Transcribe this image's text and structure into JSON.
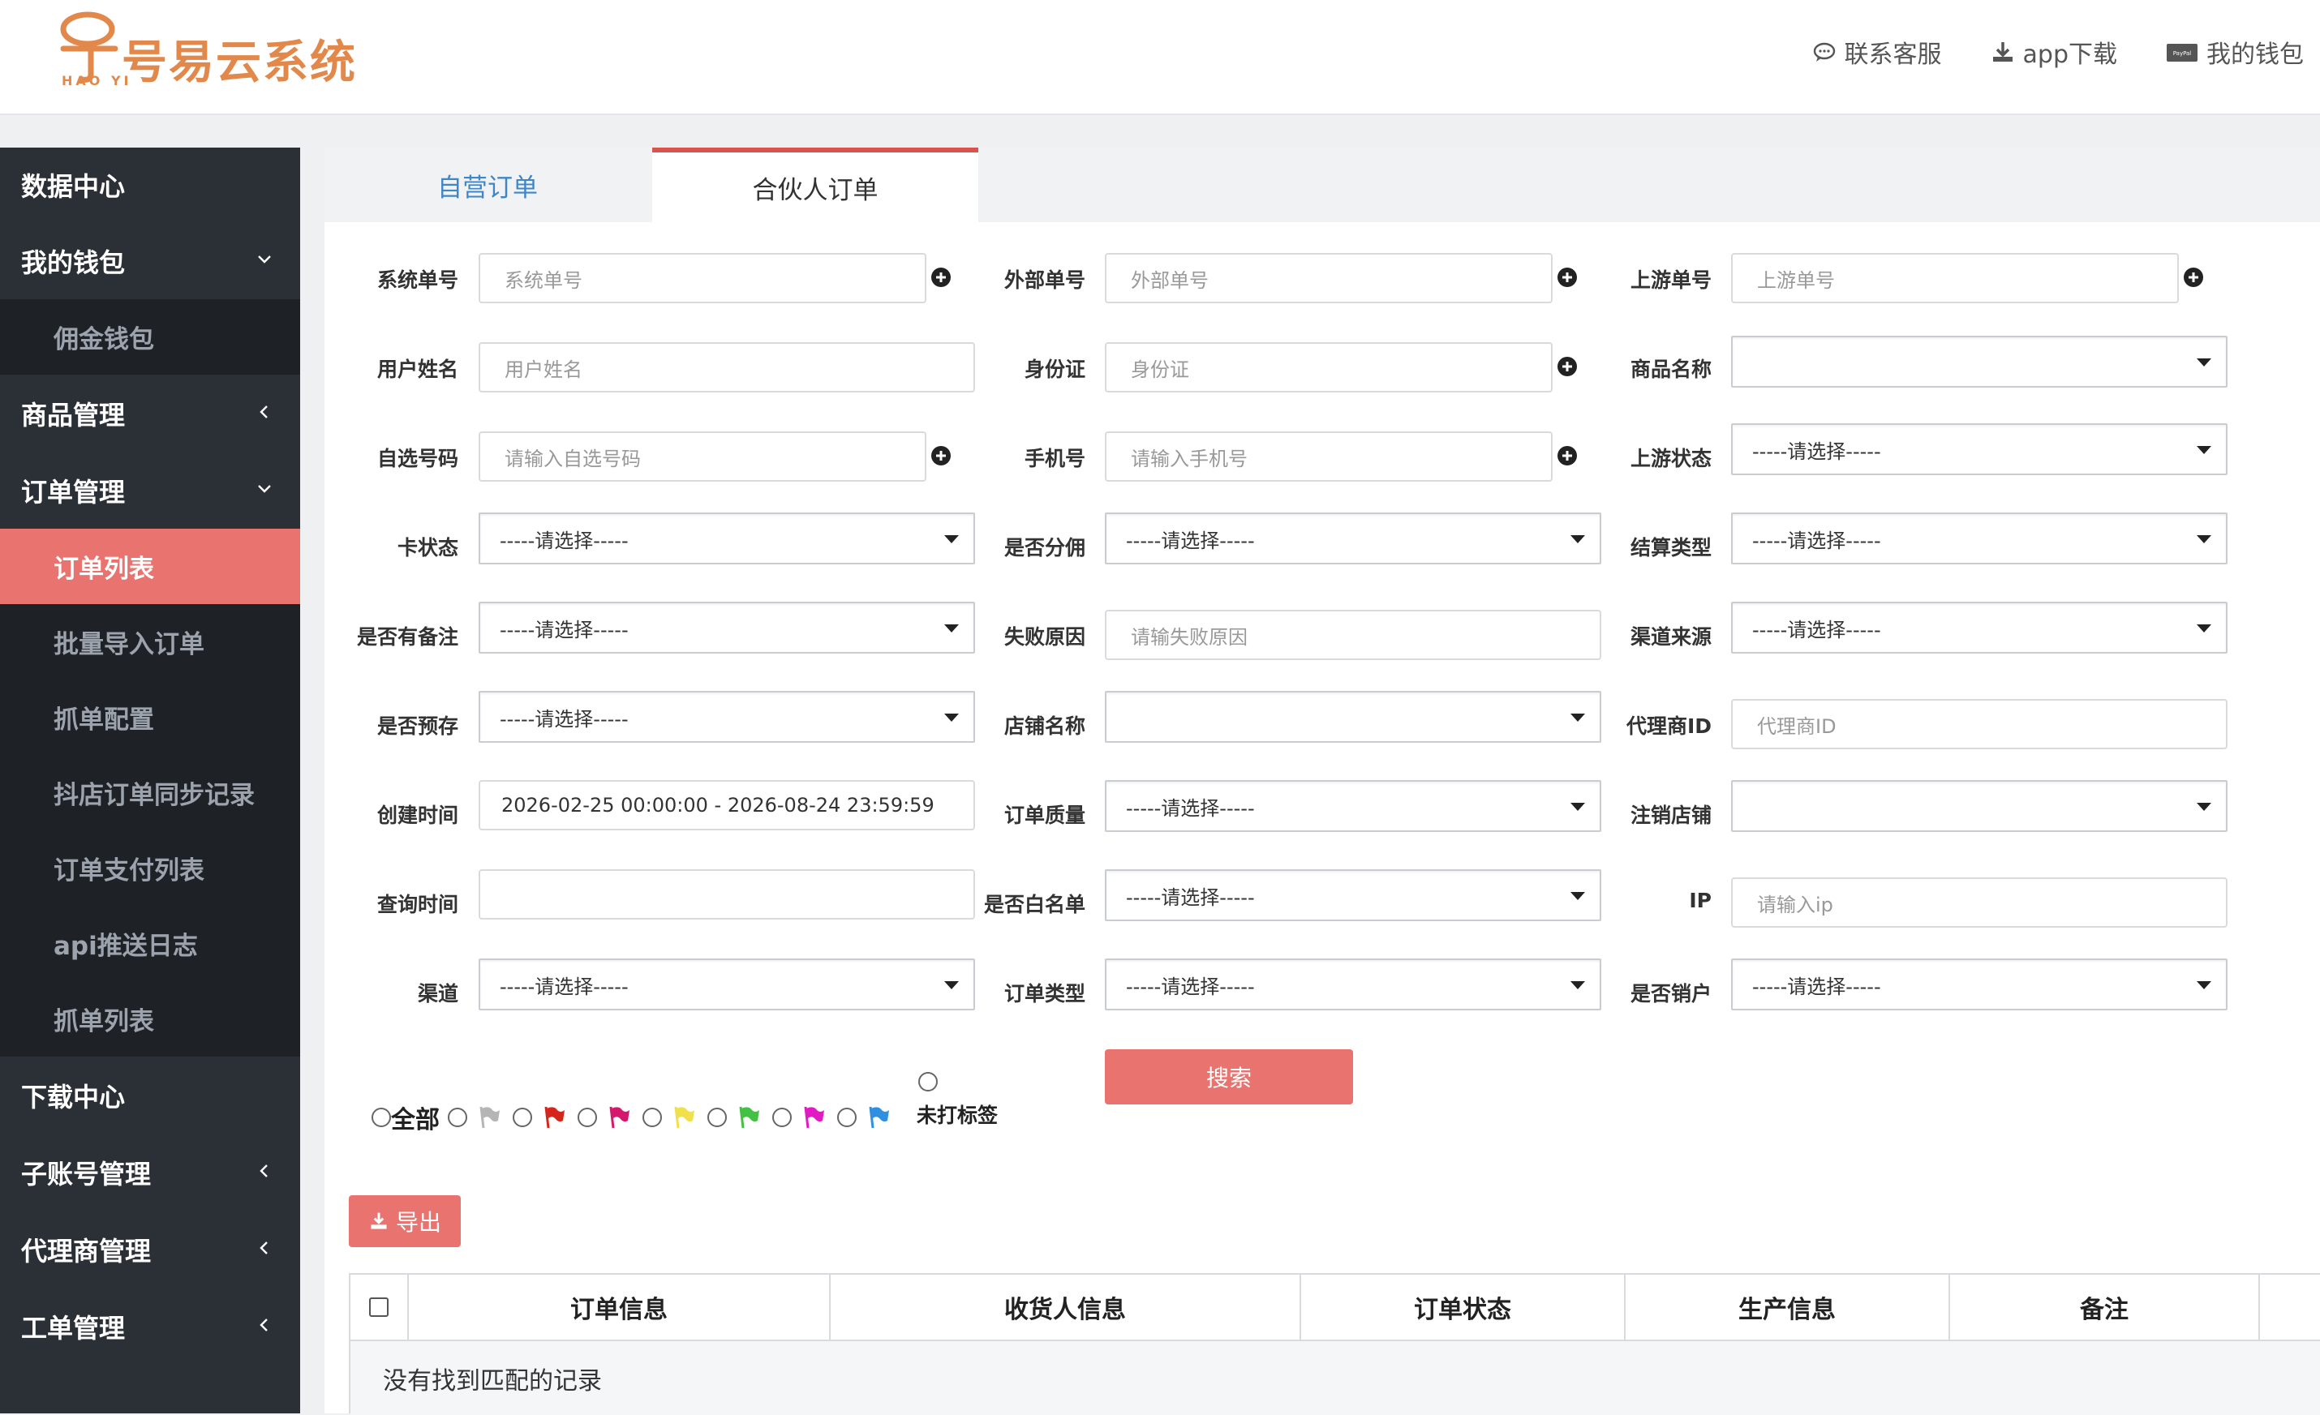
{
  "app": {
    "logo_text": "号易云系统",
    "logo_sub": "HAO YI",
    "brand_color": "#e2884a",
    "accent_color": "#e8736f"
  },
  "header": {
    "service": "联系客服",
    "download": "app下载",
    "wallet": "我的钱包"
  },
  "sidebar": {
    "items": [
      {
        "label": "数据中心",
        "icon": "none",
        "chevron": "none"
      },
      {
        "label": "我的钱包",
        "chevron": "down"
      },
      {
        "label": "佣金钱包",
        "sub": true
      },
      {
        "label": "商品管理",
        "chevron": "left"
      },
      {
        "label": "订单管理",
        "chevron": "down"
      },
      {
        "label": "订单列表",
        "sub": true,
        "active": true
      },
      {
        "label": "批量导入订单",
        "sub": true
      },
      {
        "label": "抓单配置",
        "sub": true
      },
      {
        "label": "抖店订单同步记录",
        "sub": true
      },
      {
        "label": "订单支付列表",
        "sub": true
      },
      {
        "label": "api推送日志",
        "sub": true
      },
      {
        "label": "抓单列表",
        "sub": true
      },
      {
        "label": "下载中心",
        "chevron": "none"
      },
      {
        "label": "子账号管理",
        "chevron": "left"
      },
      {
        "label": "代理商管理",
        "chevron": "left"
      },
      {
        "label": "工单管理",
        "chevron": "left"
      }
    ]
  },
  "tabs": {
    "self": "自营订单",
    "partner": "合伙人订单"
  },
  "form": {
    "sys_no": {
      "label": "系统单号",
      "placeholder": "系统单号"
    },
    "ext_no": {
      "label": "外部单号",
      "placeholder": "外部单号"
    },
    "up_no": {
      "label": "上游单号",
      "placeholder": "上游单号"
    },
    "user_name": {
      "label": "用户姓名",
      "placeholder": "用户姓名"
    },
    "id_card": {
      "label": "身份证",
      "placeholder": "身份证"
    },
    "product_name": {
      "label": "商品名称",
      "value": ""
    },
    "self_no": {
      "label": "自选号码",
      "placeholder": "请输入自选号码"
    },
    "phone": {
      "label": "手机号",
      "placeholder": "请输入手机号"
    },
    "up_status": {
      "label": "上游状态",
      "value": "-----请选择-----"
    },
    "card_status": {
      "label": "卡状态",
      "value": "-----请选择-----"
    },
    "commission": {
      "label": "是否分佣",
      "value": "-----请选择-----"
    },
    "settle_type": {
      "label": "结算类型",
      "value": "-----请选择-----"
    },
    "has_remark": {
      "label": "是否有备注",
      "value": "-----请选择-----"
    },
    "fail_reason": {
      "label": "失败原因",
      "placeholder": "请输失败原因"
    },
    "channel_src": {
      "label": "渠道来源",
      "value": "-----请选择-----"
    },
    "pre_store": {
      "label": "是否预存",
      "value": "-----请选择-----"
    },
    "shop_name": {
      "label": "店铺名称",
      "value": ""
    },
    "agent_id": {
      "label": "代理商ID",
      "placeholder": "代理商ID"
    },
    "create_time": {
      "label": "创建时间",
      "value": "2026-02-25 00:00:00 - 2026-08-24 23:59:59"
    },
    "order_quality": {
      "label": "订单质量",
      "value": "-----请选择-----"
    },
    "cancel_shop": {
      "label": "注销店铺",
      "value": ""
    },
    "query_time": {
      "label": "查询时间",
      "value": ""
    },
    "whitelist": {
      "label": "是否白名单",
      "value": "-----请选择-----"
    },
    "ip": {
      "label": "IP",
      "placeholder": "请输入ip"
    },
    "channel": {
      "label": "渠道",
      "value": "-----请选择-----"
    },
    "order_type": {
      "label": "订单类型",
      "value": "-----请选择-----"
    },
    "sold_out": {
      "label": "是否销户",
      "value": "-----请选择-----"
    }
  },
  "flags": {
    "all": "全部",
    "untagged": "未打标签",
    "colors": [
      "#b5b5b5",
      "#d6261c",
      "#d3186d",
      "#f0e04b",
      "#43c144",
      "#e11ac4",
      "#2f8fe0"
    ]
  },
  "buttons": {
    "search": "搜索",
    "export": "导出"
  },
  "table": {
    "columns": [
      "订单信息",
      "收货人信息",
      "订单状态",
      "生产信息",
      "备注"
    ],
    "empty": "没有找到匹配的记录"
  }
}
